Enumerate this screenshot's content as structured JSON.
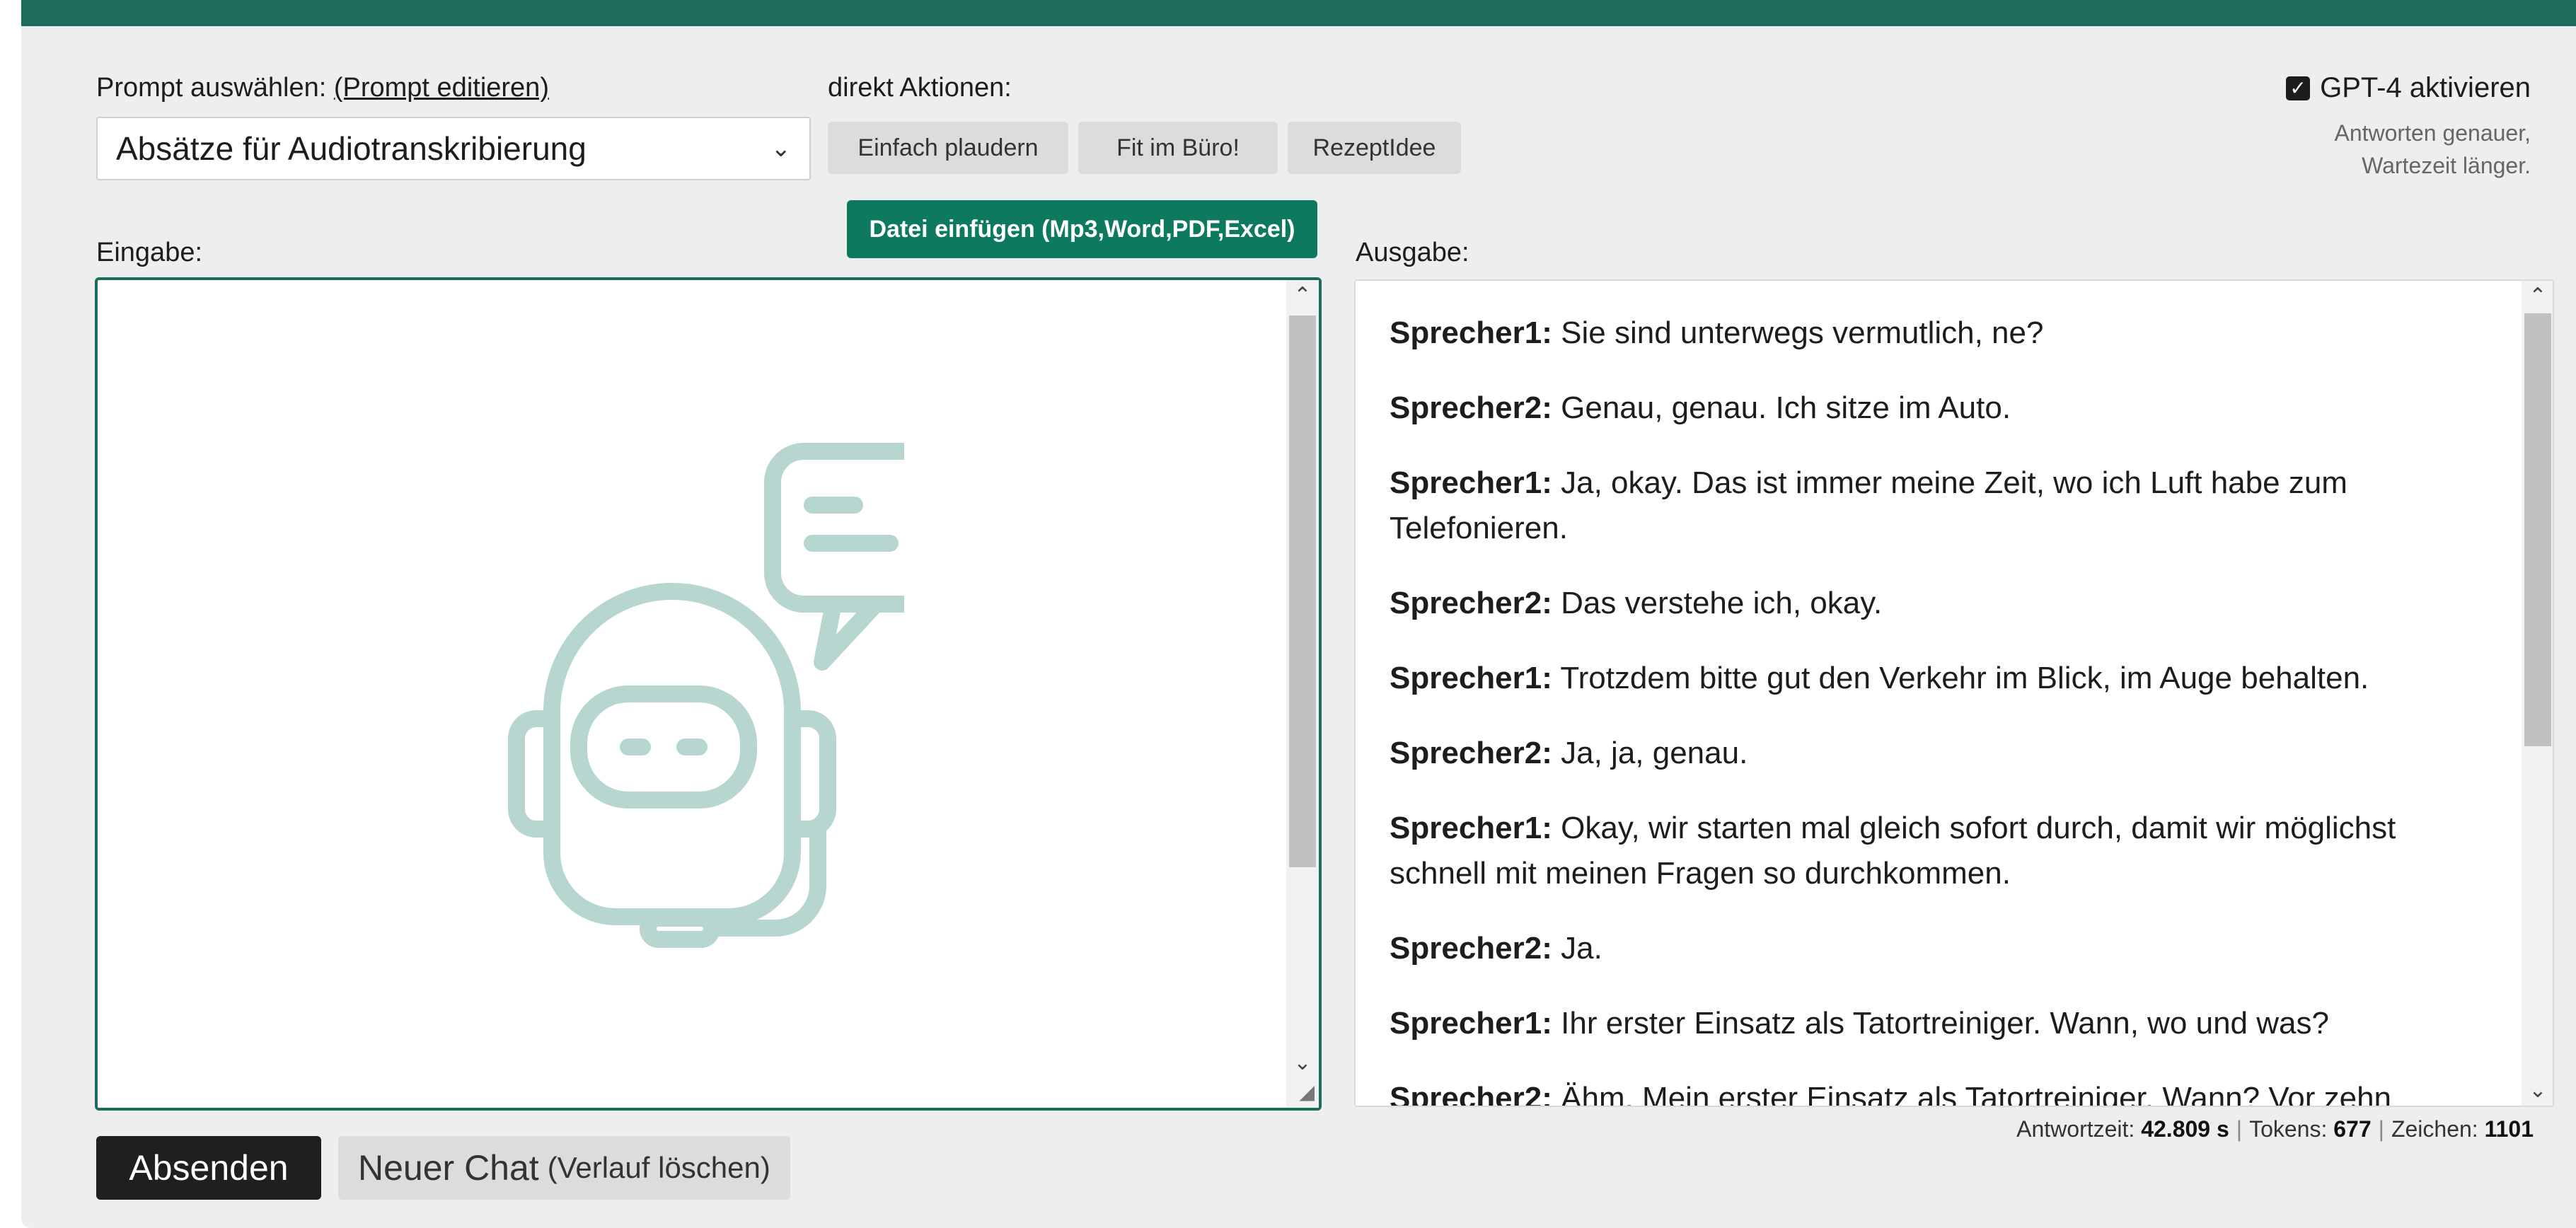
{
  "colors": {
    "accent": "#1c6b5c",
    "primary_button": "#0d7a5f",
    "robot_icon": "#b7d6cf"
  },
  "prompt": {
    "label": "Prompt auswählen:",
    "edit_link": "(Prompt editieren)",
    "selected": "Absätze für Audiotranskribierung"
  },
  "actions": {
    "label": "direkt Aktionen:",
    "buttons": [
      "Einfach plaudern",
      "Fit im Büro!",
      "RezeptIdee"
    ],
    "file_button": "Datei einfügen (Mp3,Word,PDF,Excel)"
  },
  "gpt4": {
    "label": "GPT-4 aktivieren",
    "checked": true,
    "note_line1": "Antworten genauer,",
    "note_line2": "Wartezeit länger."
  },
  "input": {
    "label": "Eingabe:",
    "icon": "chatbot-icon",
    "value": ""
  },
  "output": {
    "label": "Ausgabe:",
    "messages": [
      {
        "speaker": "Sprecher1:",
        "text": "Sie sind unterwegs vermutlich, ne?"
      },
      {
        "speaker": "Sprecher2:",
        "text": "Genau, genau. Ich sitze im Auto."
      },
      {
        "speaker": "Sprecher1:",
        "text": "Ja, okay. Das ist immer meine Zeit, wo ich Luft habe zum Telefonieren."
      },
      {
        "speaker": "Sprecher2:",
        "text": "Das verstehe ich, okay."
      },
      {
        "speaker": "Sprecher1:",
        "text": "Trotzdem bitte gut den Verkehr im Blick, im Auge behalten."
      },
      {
        "speaker": "Sprecher2:",
        "text": "Ja, ja, genau."
      },
      {
        "speaker": "Sprecher1:",
        "text": "Okay, wir starten mal gleich sofort durch, damit wir möglichst schnell mit meinen Fragen so durchkommen."
      },
      {
        "speaker": "Sprecher2:",
        "text": "Ja."
      },
      {
        "speaker": "Sprecher1:",
        "text": "Ihr erster Einsatz als Tatortreiniger. Wann, wo und was?"
      },
      {
        "speaker": "Sprecher2:",
        "text": "Ähm. Mein erster Einsatz als Tatortreiniger. Wann? Vor zehn"
      }
    ]
  },
  "stats": {
    "time_label": "Antwortzeit:",
    "time_value": "42.809 s",
    "tokens_label": "Tokens:",
    "tokens_value": "677",
    "chars_label": "Zeichen:",
    "chars_value": "1101"
  },
  "buttons": {
    "send": "Absenden",
    "new_chat": "Neuer Chat",
    "new_chat_hint": "(Verlauf löschen)"
  }
}
